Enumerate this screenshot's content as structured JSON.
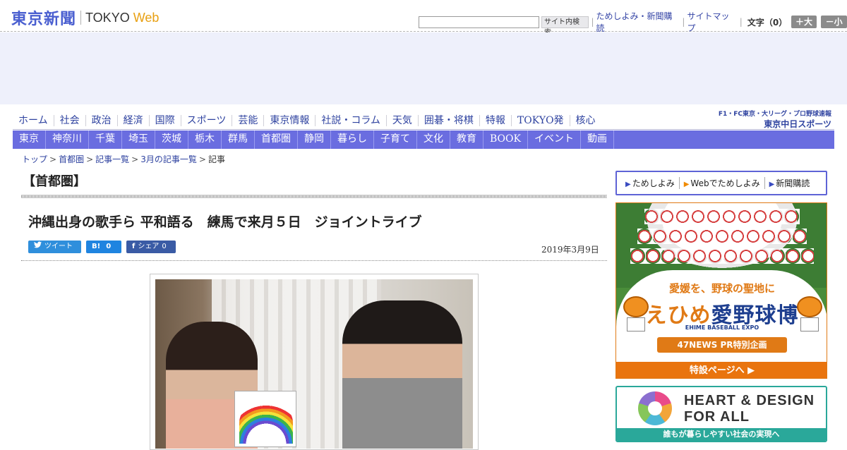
{
  "header": {
    "logo_jp": "東京新聞",
    "logo_en": "TOKYO",
    "logo_web": "Web",
    "search_button": "サイト内検索",
    "links": [
      "ためしよみ・新聞購読",
      "サイトマップ"
    ],
    "font_label": "文字（0）",
    "font_up": "＋大",
    "font_down": "－小"
  },
  "nav_primary": [
    "ホーム",
    "社会",
    "政治",
    "経済",
    "国際",
    "スポーツ",
    "芸能",
    "東京情報",
    "社説・コラム",
    "天気",
    "囲碁・将棋",
    "特報",
    "TOKYO発",
    "核心"
  ],
  "chunichi": {
    "line1": "F1・FC東京・大リーグ・プロ野球速報",
    "line2": "東京中日スポーツ"
  },
  "nav_regions": [
    "東京",
    "神奈川",
    "千葉",
    "埼玉",
    "茨城",
    "栃木",
    "群馬",
    "首都圏",
    "静岡",
    "暮らし",
    "子育て",
    "文化",
    "教育",
    "BOOK",
    "イベント",
    "動画"
  ],
  "breadcrumb": [
    "トップ",
    "首都圏",
    "記事一覧",
    "3月の記事一覧",
    "記事"
  ],
  "article": {
    "section": "【首都圏】",
    "headline": "沖縄出身の歌手ら 平和語る　練馬で来月５日　ジョイントライブ",
    "date": "2019年3月9日",
    "share": {
      "tweet_label": "ツイート",
      "hatena_icon": "B!",
      "hatena_count": "0",
      "fb_icon": "f",
      "fb_label": "シェア",
      "fb_count": "0"
    }
  },
  "sidebar": {
    "nav": [
      "ためしよみ",
      "Webでためしよみ",
      "新聞購読"
    ],
    "ad1": {
      "line1": "愛媛を、野球の聖地に",
      "line2a": "えひめ",
      "line2b": "愛",
      "line2c": "野球博",
      "line3": "EHIME BASEBALL EXPO",
      "badge": "47NEWS PR特別企画",
      "footer": "特設ページへ ▶"
    },
    "ad2": {
      "title1": "HEART & DESIGN",
      "title2": "FOR ALL",
      "footer": "誰もが暮らしやすい社会の実現へ"
    }
  },
  "colors": {
    "brand": "#4a5fd0",
    "nav_bar": "#6a6de0",
    "accent_orange": "#e07a16",
    "teal": "#2aa89a"
  }
}
